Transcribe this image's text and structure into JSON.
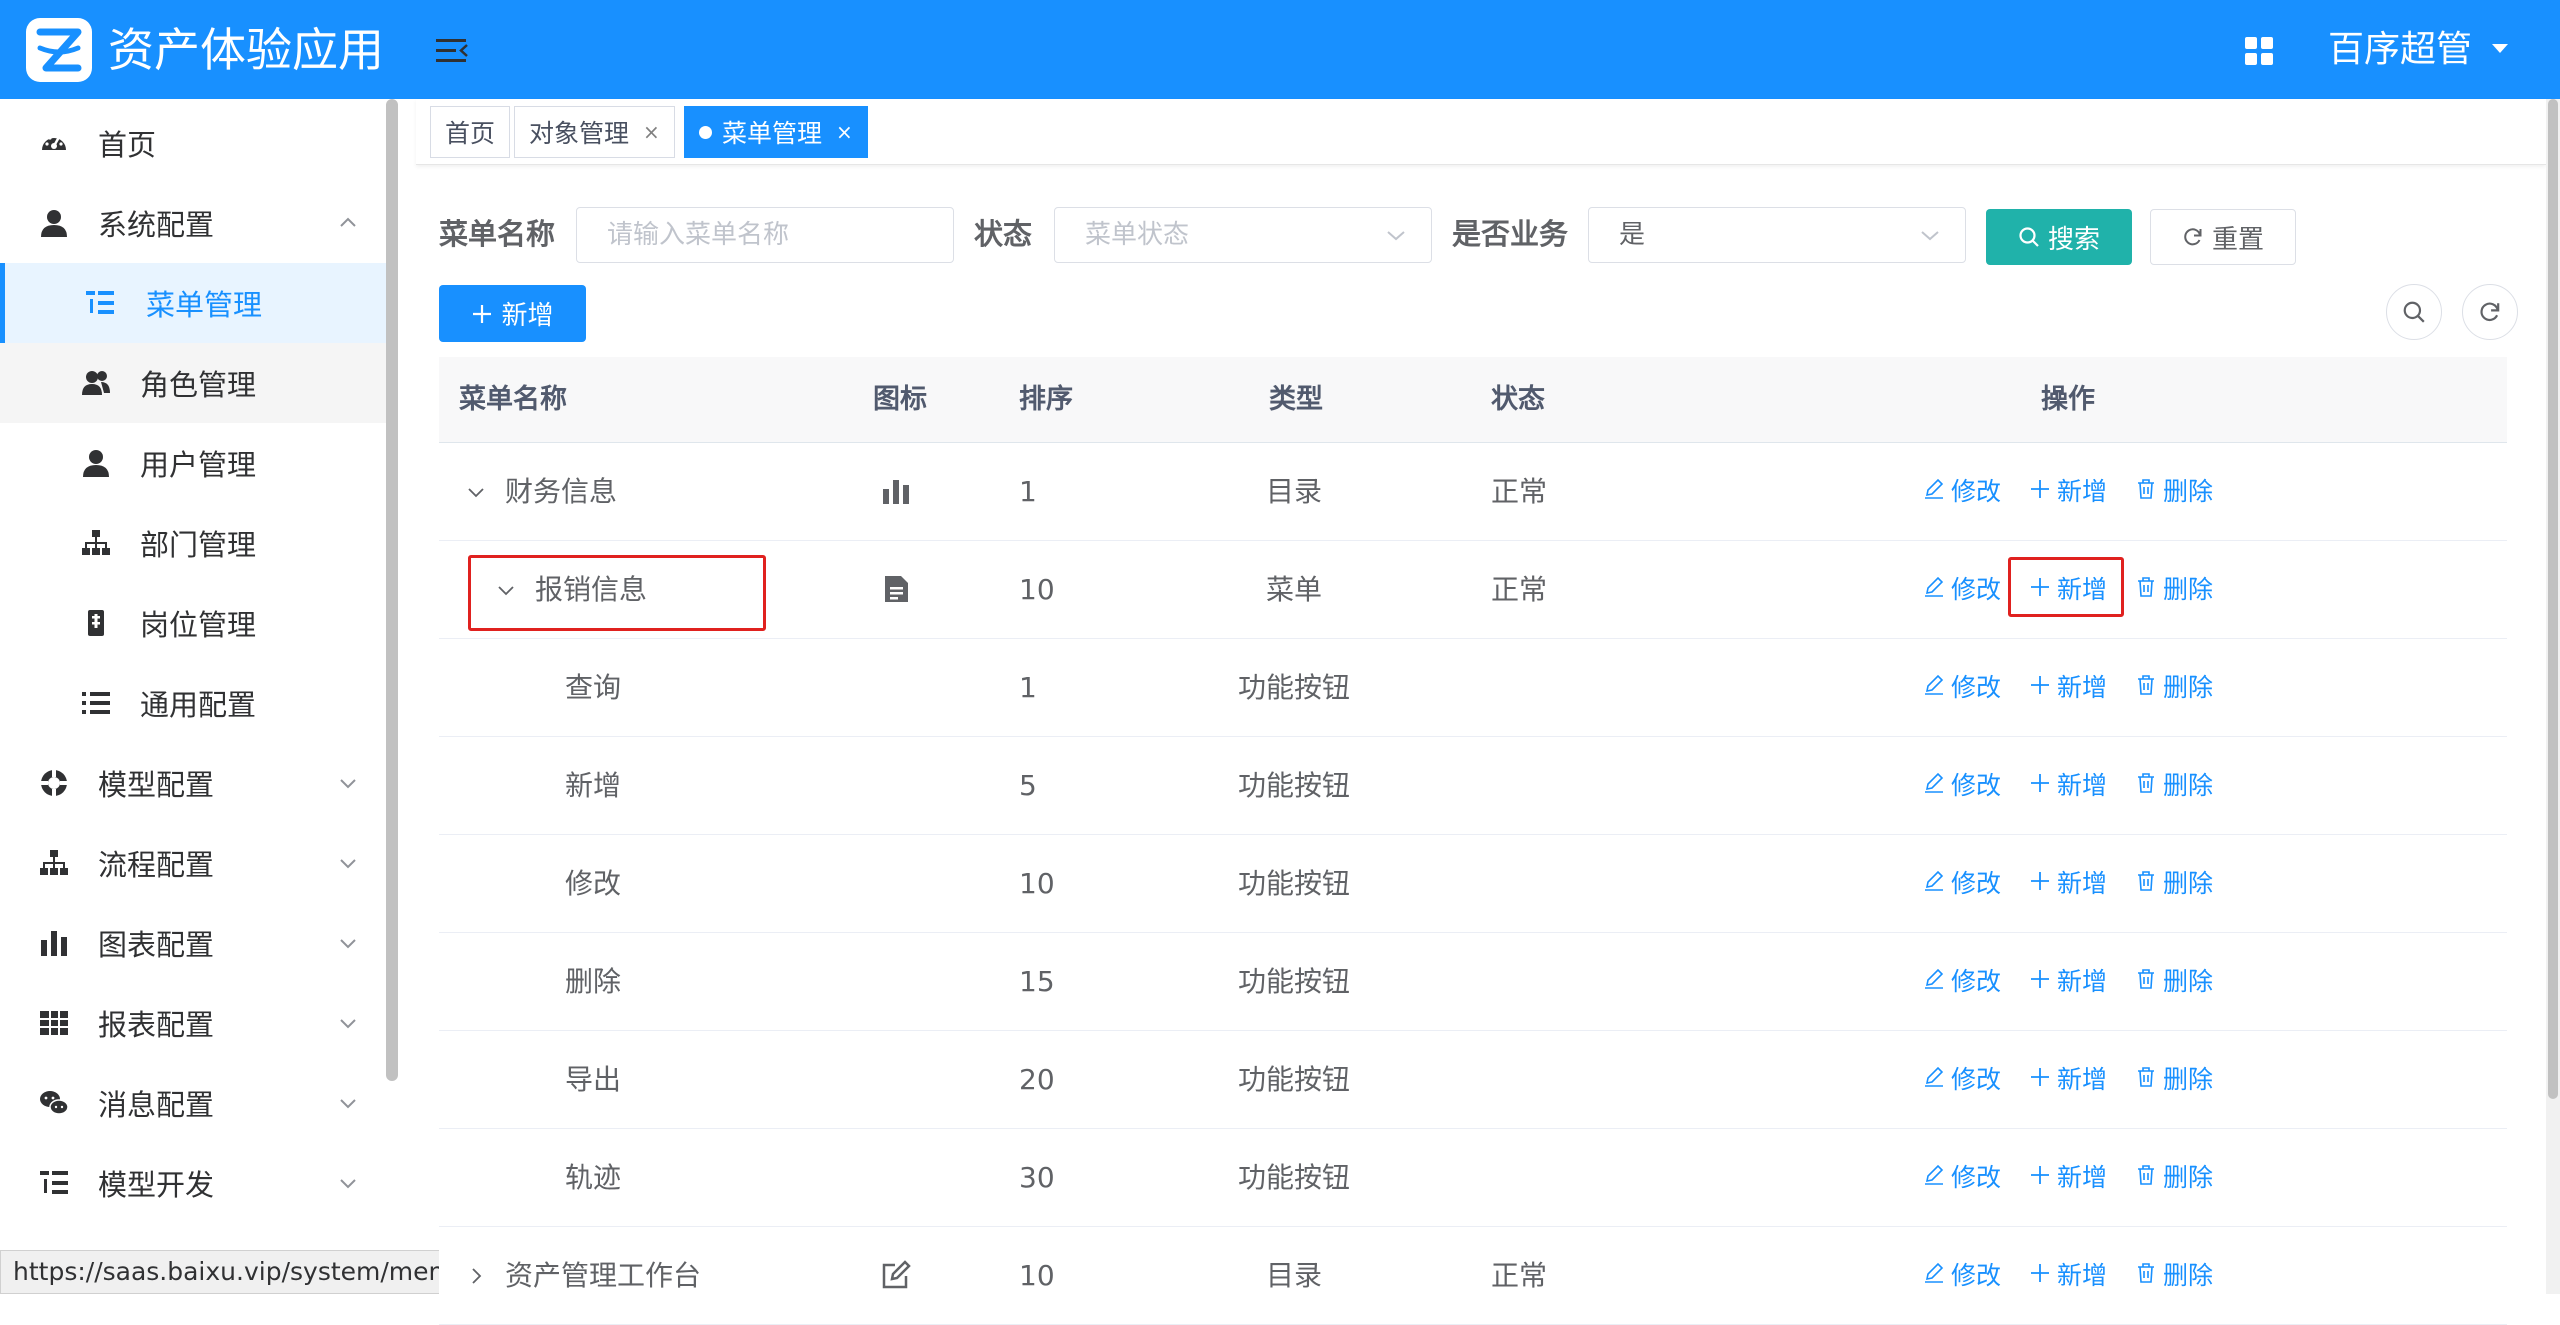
{
  "header": {
    "app_title": "资产体验应用",
    "user_name": "百序超管"
  },
  "sidebar": {
    "items": [
      {
        "label": "首页",
        "icon": "dashboard-icon"
      },
      {
        "label": "系统配置",
        "icon": "user-icon",
        "expanded": true
      },
      {
        "label": "菜单管理",
        "icon": "tree-table-icon",
        "active": true
      },
      {
        "label": "角色管理",
        "icon": "peoples-icon"
      },
      {
        "label": "用户管理",
        "icon": "user-icon"
      },
      {
        "label": "部门管理",
        "icon": "tree-icon"
      },
      {
        "label": "岗位管理",
        "icon": "post-icon"
      },
      {
        "label": "通用配置",
        "icon": "list-icon"
      },
      {
        "label": "模型配置",
        "icon": "model-icon"
      },
      {
        "label": "流程配置",
        "icon": "tree-icon"
      },
      {
        "label": "图表配置",
        "icon": "bar-chart-icon"
      },
      {
        "label": "报表配置",
        "icon": "grid-icon"
      },
      {
        "label": "消息配置",
        "icon": "wechat-icon"
      },
      {
        "label": "模型开发",
        "icon": "tree-table-icon"
      }
    ]
  },
  "status_url": "https://saas.baixu.vip/system/menu",
  "tabs": [
    {
      "label": "首页"
    },
    {
      "label": "对象管理",
      "close": "×"
    },
    {
      "label": "菜单管理",
      "close": "×",
      "active": true
    }
  ],
  "search": {
    "menu_name_label": "菜单名称",
    "menu_name_placeholder": "请输入菜单名称",
    "status_label": "状态",
    "status_placeholder": "菜单状态",
    "business_label": "是否业务",
    "business_value": "是",
    "search_button": "搜索",
    "reset_button": "重置"
  },
  "toolbar": {
    "add_button": "新增"
  },
  "table": {
    "headers": {
      "name": "菜单名称",
      "icon": "图标",
      "sort": "排序",
      "type": "类型",
      "status": "状态",
      "ops": "操作"
    },
    "actions": {
      "edit": "修改",
      "add": "新增",
      "delete": "删除"
    },
    "rows": [
      {
        "name": "财务信息",
        "icon": "bar-chart-icon",
        "sort": "1",
        "type": "目录",
        "status": "正常",
        "level": 0,
        "expand": "down"
      },
      {
        "name": "报销信息",
        "icon": "document-icon",
        "sort": "10",
        "type": "菜单",
        "status": "正常",
        "level": 1,
        "expand": "down"
      },
      {
        "name": "查询",
        "icon": "",
        "sort": "1",
        "type": "功能按钮",
        "status": "",
        "level": 2
      },
      {
        "name": "新增",
        "icon": "",
        "sort": "5",
        "type": "功能按钮",
        "status": "",
        "level": 2
      },
      {
        "name": "修改",
        "icon": "",
        "sort": "10",
        "type": "功能按钮",
        "status": "",
        "level": 2
      },
      {
        "name": "删除",
        "icon": "",
        "sort": "15",
        "type": "功能按钮",
        "status": "",
        "level": 2
      },
      {
        "name": "导出",
        "icon": "",
        "sort": "20",
        "type": "功能按钮",
        "status": "",
        "level": 2
      },
      {
        "name": "轨迹",
        "icon": "",
        "sort": "30",
        "type": "功能按钮",
        "status": "",
        "level": 2
      },
      {
        "name": "资产管理工作台",
        "icon": "edit-icon",
        "sort": "10",
        "type": "目录",
        "status": "正常",
        "level": 0,
        "expand": "right"
      }
    ]
  },
  "colors": {
    "primary": "#1890ff",
    "search_button": "#20b2aa",
    "highlight": "#e0211f"
  }
}
